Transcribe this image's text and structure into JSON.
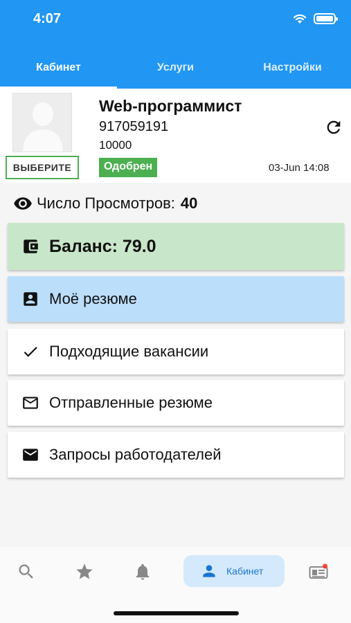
{
  "status": {
    "time": "4:07"
  },
  "tabs": [
    {
      "label": "Кабинет",
      "active": true
    },
    {
      "label": "Услуги",
      "active": false
    },
    {
      "label": "Настройки",
      "active": false
    }
  ],
  "profile": {
    "name": "Web-программист",
    "phone": "917059191",
    "amount": "10000",
    "select_label": "ВЫБЕРИТЕ",
    "status_badge": "Одобрен",
    "datetime": "03-Jun 14:08"
  },
  "views": {
    "label": "Число Просмотров:",
    "count": "40"
  },
  "menu": {
    "balance": "Баланс: 79.0",
    "resume": "Моё резюме",
    "vacancies": "Подходящие вакансии",
    "sent": "Отправленные резюме",
    "requests": "Запросы работодателей"
  },
  "bottom_nav": {
    "items": [
      "search-icon",
      "star-icon",
      "bell-icon",
      "person-icon",
      "newspaper-icon"
    ],
    "active_label": "Кабинет"
  },
  "colors": {
    "primary": "#2196f3",
    "approved": "#4caf50",
    "balance_bg": "#c8e6c9",
    "resume_bg": "#bbdefb",
    "nav_active_bg": "#d4e9fb"
  }
}
